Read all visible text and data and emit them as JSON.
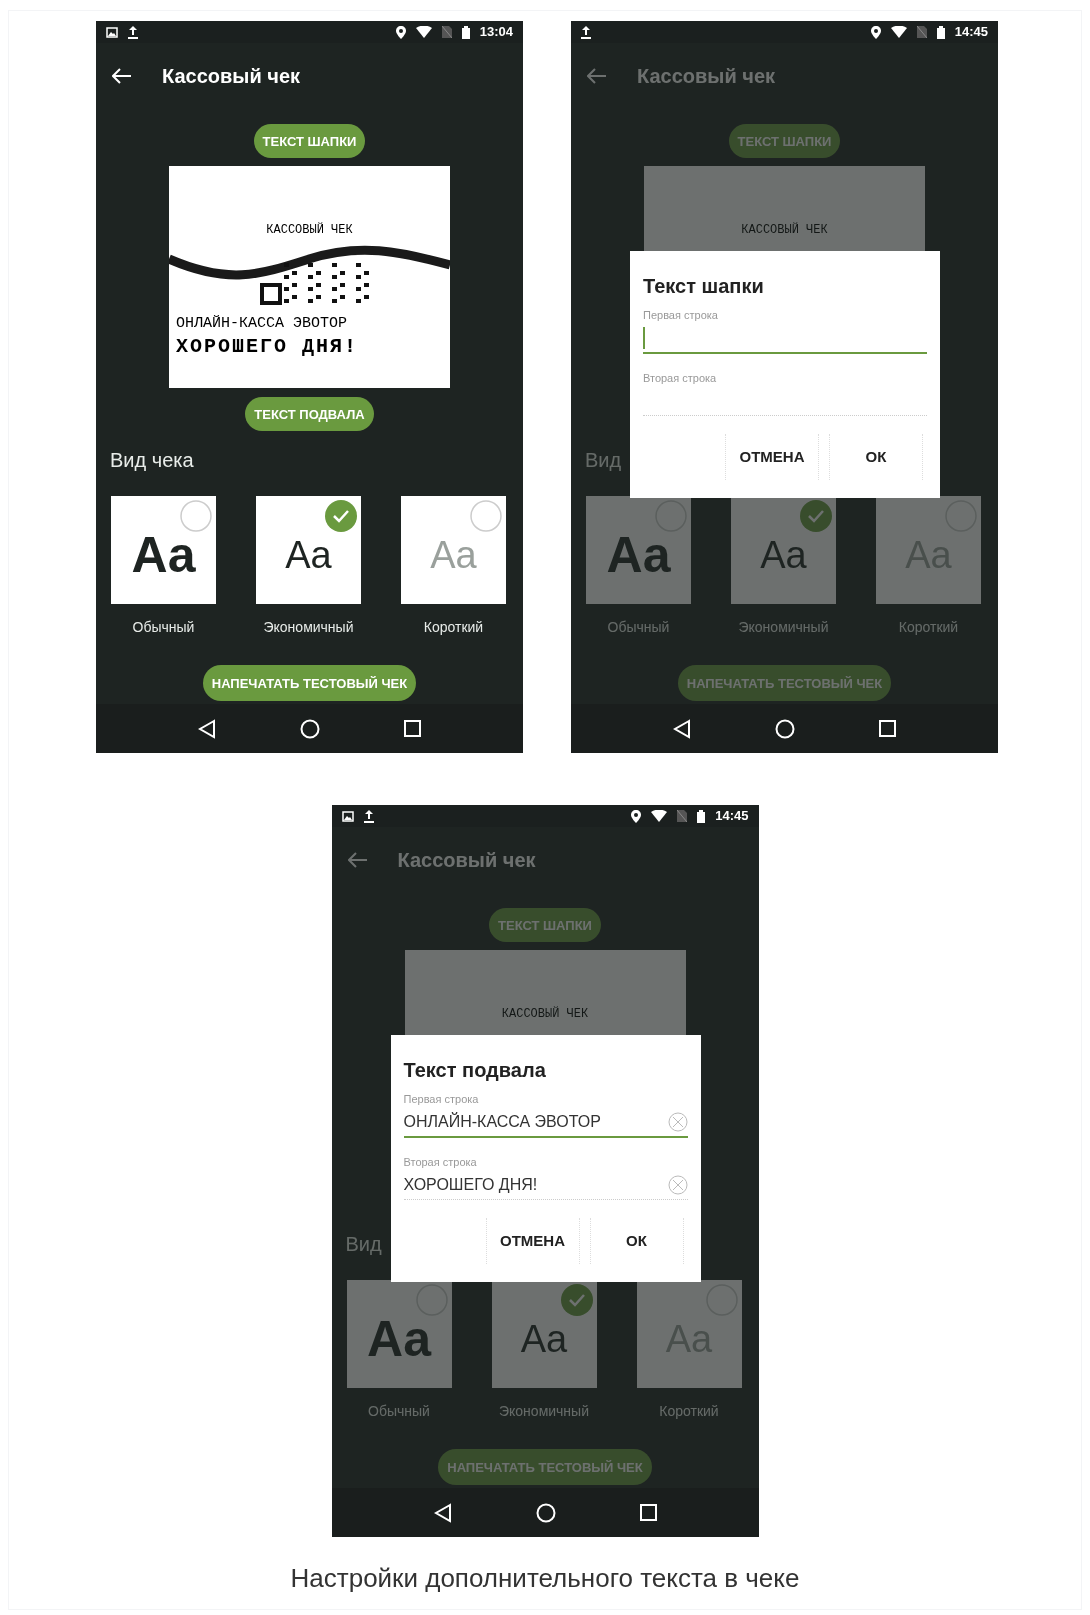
{
  "screens": [
    {
      "status_bar": {
        "notifications": [
          {
            "kind": "image"
          },
          {
            "kind": "upload"
          }
        ],
        "time": "13:04"
      },
      "title": "Кассовый чек",
      "header_button": "ТЕКСТ ШАПКИ",
      "receipt": {
        "heading": "КАССОВЫЙ ЧЕК",
        "footer_lines": [
          "ОНЛАЙН-КАССА ЭВОТОР",
          "ХОРОШЕГО ДНЯ!"
        ]
      },
      "footer_button": "ТЕКСТ ПОДВАЛА",
      "section_title": "Вид чека",
      "styles": [
        {
          "kind": "bold",
          "sample": "Aa",
          "label": "Обычный",
          "selected": false
        },
        {
          "kind": "regular",
          "sample": "Aa",
          "label": "Экономичный",
          "selected": true
        },
        {
          "kind": "light",
          "sample": "Aa",
          "label": "Короткий",
          "selected": false
        }
      ],
      "print_button": "НАПЕЧАТАТЬ ТЕСТОВЫЙ ЧЕК"
    },
    {
      "status_bar": {
        "notifications": [
          {
            "kind": "upload"
          }
        ],
        "time": "14:45"
      },
      "title": "Кассовый чек",
      "header_button": "ТЕКСТ ШАПКИ",
      "receipt": {
        "heading": "КАССОВЫЙ ЧЕК"
      },
      "section_title": "Вид",
      "styles": [
        {
          "kind": "bold",
          "sample": "Aa",
          "label": "Обычный",
          "selected": false
        },
        {
          "kind": "regular",
          "sample": "Aa",
          "label": "Экономичный",
          "selected": true
        },
        {
          "kind": "light",
          "sample": "Aa",
          "label": "Короткий",
          "selected": false
        }
      ],
      "print_button": "НАПЕЧАТАТЬ ТЕСТОВЫЙ ЧЕК",
      "dialog": {
        "title": "Текст шапки",
        "fields": [
          {
            "label": "Первая строка",
            "focused": true
          },
          {
            "label": "Вторая строка",
            "focused": false
          }
        ],
        "buttons": [
          "ОТМЕНА",
          "ОК"
        ]
      }
    },
    {
      "status_bar": {
        "notifications": [
          {
            "kind": "image"
          },
          {
            "kind": "upload"
          }
        ],
        "time": "14:45"
      },
      "title": "Кассовый чек",
      "header_button": "ТЕКСТ ШАПКИ",
      "receipt": {
        "heading": "КАССОВЫЙ ЧЕК"
      },
      "section_title": "Вид",
      "styles": [
        {
          "kind": "bold",
          "sample": "Aa",
          "label": "Обычный",
          "selected": false
        },
        {
          "kind": "regular",
          "sample": "Aa",
          "label": "Экономичный",
          "selected": true
        },
        {
          "kind": "light",
          "sample": "Aa",
          "label": "Короткий",
          "selected": false
        }
      ],
      "print_button": "НАПЕЧАТАТЬ ТЕСТОВЫЙ ЧЕК",
      "dialog": {
        "title": "Текст подвала",
        "fields": [
          {
            "label": "Первая строка",
            "value": "ОНЛАЙН-КАССА ЭВОТОР",
            "focused": true
          },
          {
            "label": "Вторая строка",
            "value": "ХОРОШЕГО ДНЯ!",
            "focused": false
          }
        ],
        "buttons": [
          "ОТМЕНА",
          "ОК"
        ]
      }
    }
  ],
  "caption": "Настройки дополнительного текста в чеке"
}
